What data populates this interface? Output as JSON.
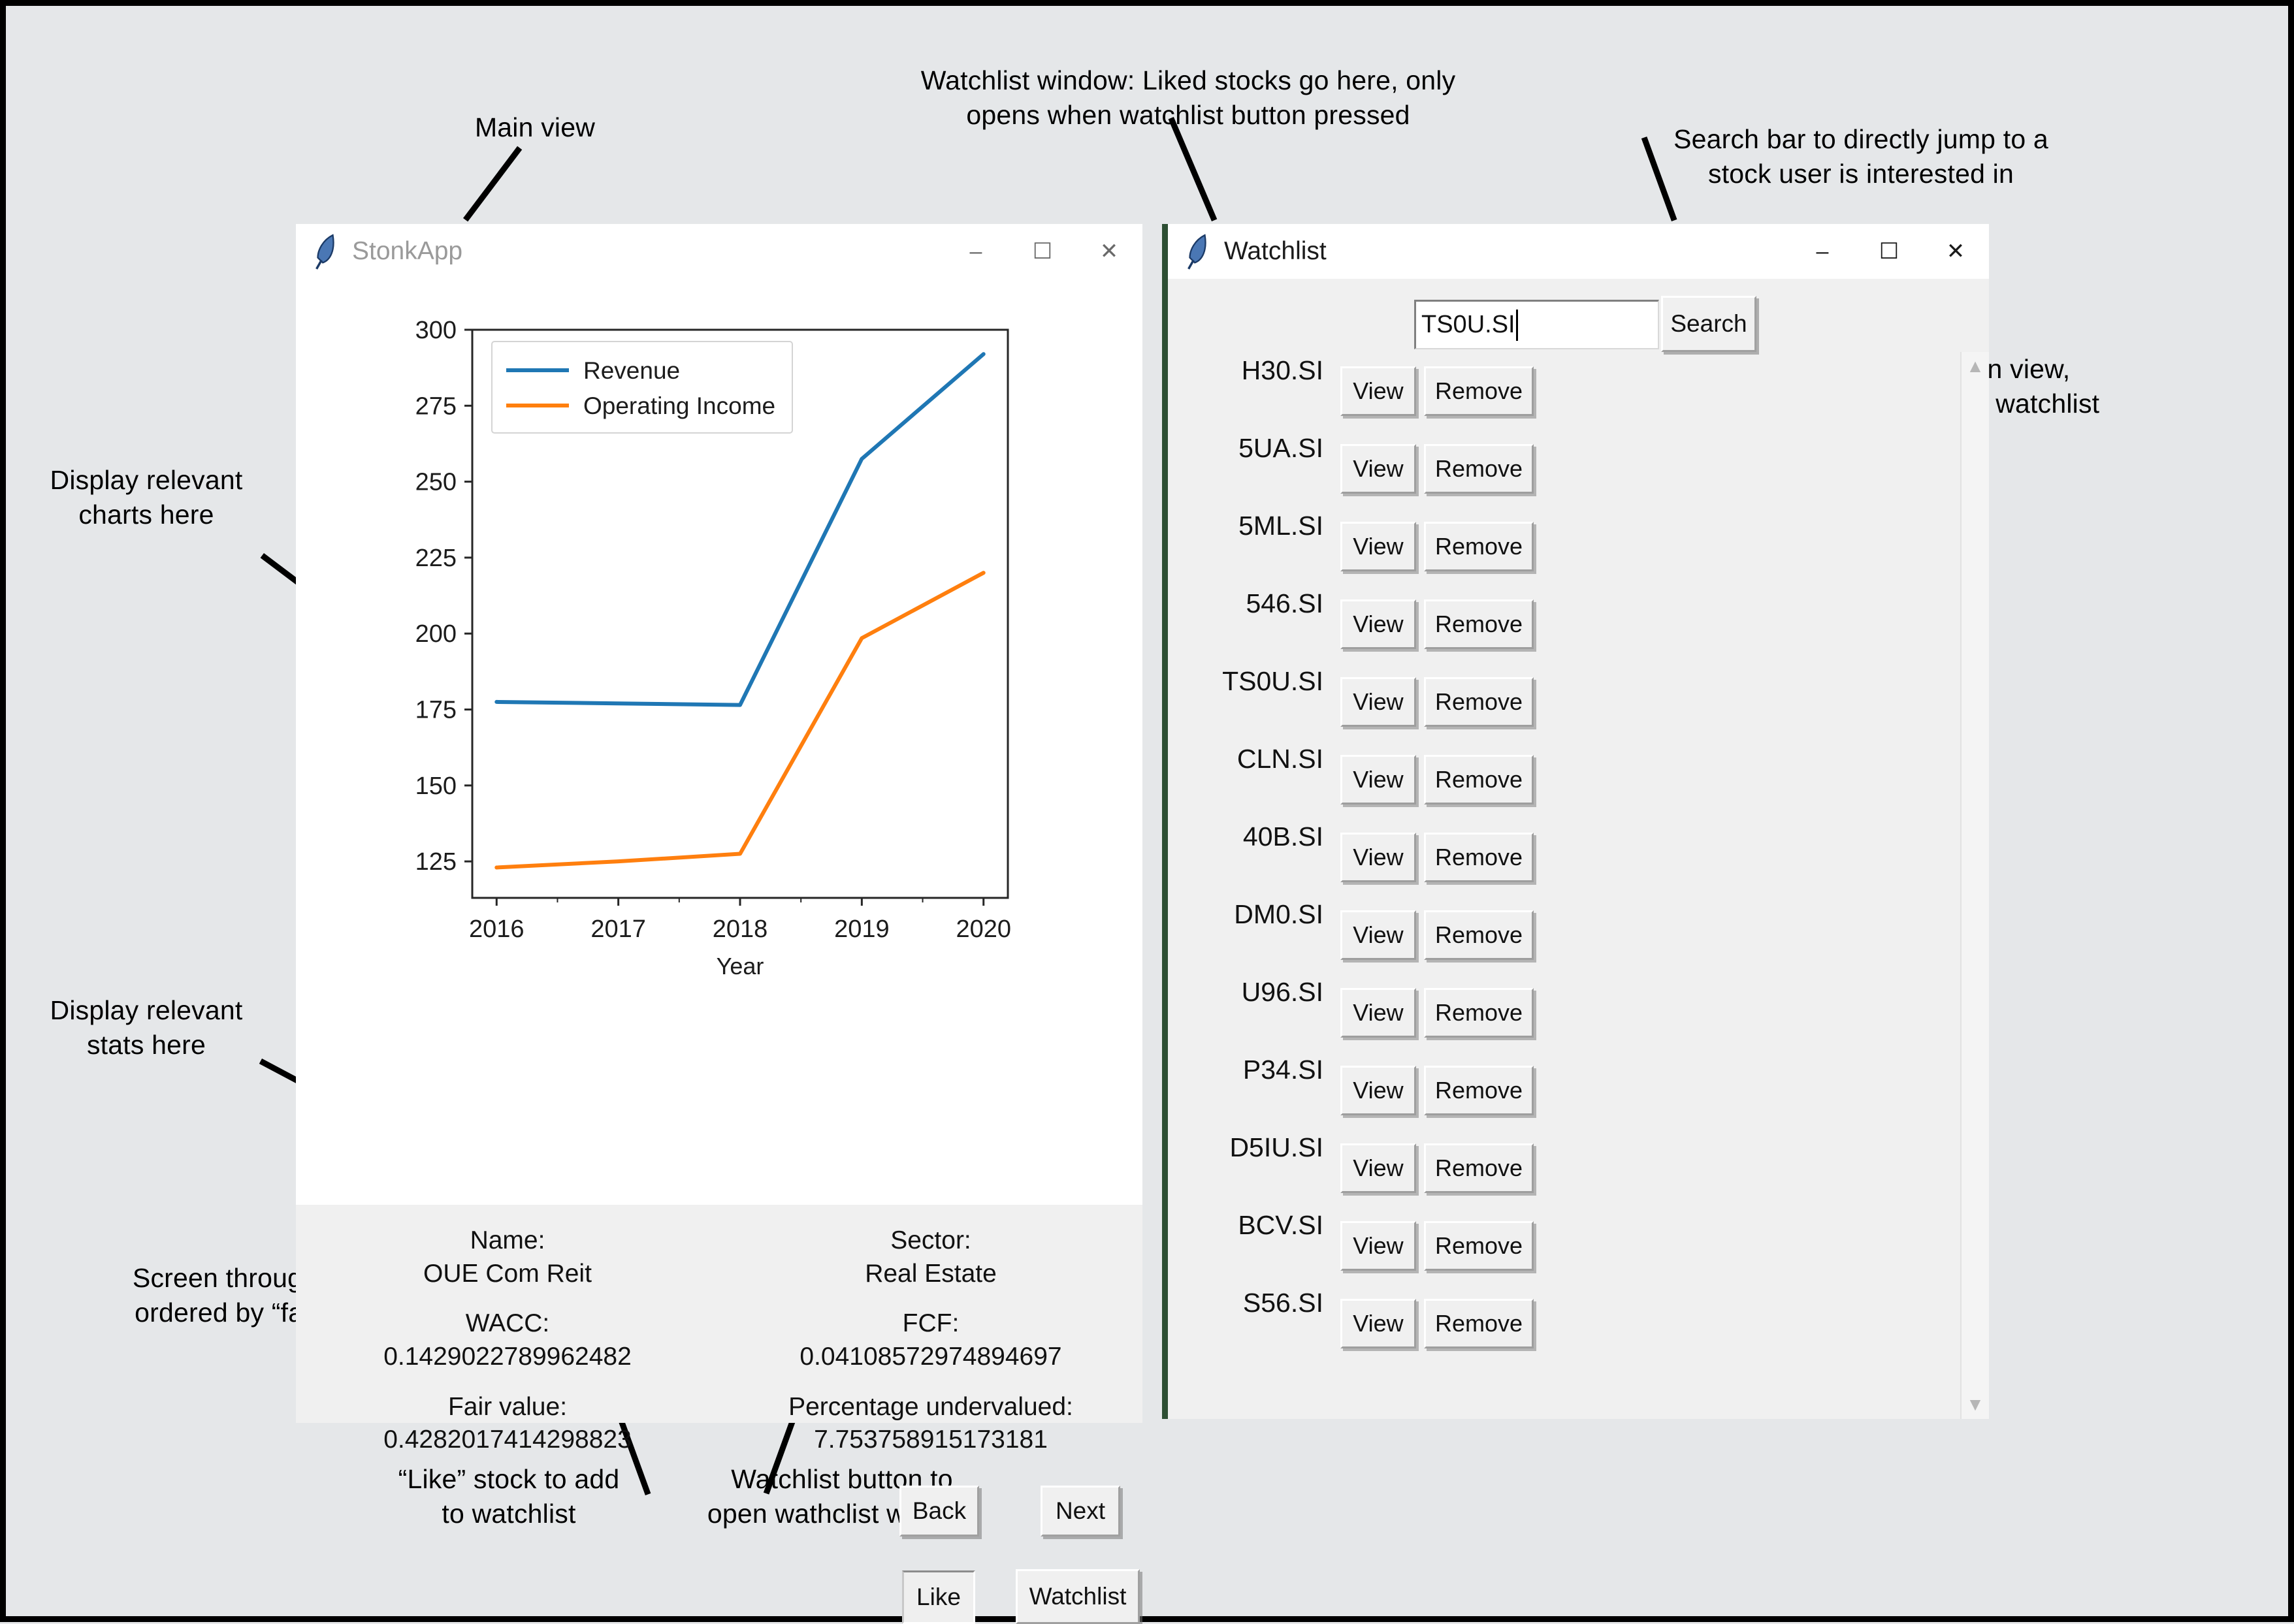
{
  "canvas": {
    "bg": "#e5e7e9",
    "border": "#000000"
  },
  "annotations": [
    {
      "name": "main-view",
      "text": "Main view"
    },
    {
      "name": "watchlist-window",
      "text": "Watchlist window: Liked stocks go here, only\nopens when watchlist button pressed"
    },
    {
      "name": "search-bar",
      "text": "Search bar to directly jump to a\nstock user is interested in"
    },
    {
      "name": "view-remove",
      "text": "“View” stock to display in main view,\n“Remove” stock to remove from watchlist"
    },
    {
      "name": "charts-here",
      "text": "Display relevant\ncharts here"
    },
    {
      "name": "stats-here",
      "text": "Display relevant\nstats here"
    },
    {
      "name": "screen-stocks",
      "text": "Screen through stocks\nordered by “fair value”"
    },
    {
      "name": "like-stock",
      "text": "“Like” stock to add\nto watchlist"
    },
    {
      "name": "watchlist-button",
      "text": "Watchlist button to\nopen wathclist window"
    }
  ],
  "stonkapp": {
    "title": "StonkApp",
    "icon": "feather-icon",
    "controls": {
      "minimize": "–",
      "maximize": "☐",
      "close": "✕"
    },
    "stats": [
      {
        "label": "Name:",
        "value": "OUE Com Reit"
      },
      {
        "label": "Sector:",
        "value": "Real Estate"
      },
      {
        "label": "WACC:",
        "value": "0.1429022789962482"
      },
      {
        "label": "FCF:",
        "value": "0.04108572974894697"
      },
      {
        "label": "Fair value:",
        "value": "0.4282017414298823"
      },
      {
        "label": "Percentage undervalued:",
        "value": "7.753758915173181"
      }
    ],
    "buttons": {
      "back": "Back",
      "next": "Next",
      "like": "Like",
      "watchlist": "Watchlist"
    }
  },
  "chart_data": {
    "type": "line",
    "title": "",
    "xlabel": "Year",
    "ylabel": "",
    "x": [
      2016,
      2017,
      2018,
      2019,
      2020
    ],
    "categories": [
      "2016",
      "2017",
      "2018",
      "2019",
      "2020"
    ],
    "series": [
      {
        "name": "Revenue",
        "color": "#1f77b4",
        "values": [
          177.5,
          177.0,
          176.5,
          257.5,
          292.0
        ]
      },
      {
        "name": "Operating Income",
        "color": "#ff7f0e",
        "values": [
          123.0,
          125.0,
          127.5,
          198.5,
          220.0
        ]
      }
    ],
    "xticks": [
      "2016",
      "2017",
      "2018",
      "2019",
      "2020"
    ],
    "yticks": [
      "125",
      "150",
      "175",
      "200",
      "225",
      "250",
      "275",
      "300"
    ],
    "ylim": [
      113,
      300
    ],
    "xlim": [
      2015.8,
      2020.2
    ],
    "grid": false,
    "legend_position": "upper left",
    "legend": [
      "Revenue",
      "Operating Income"
    ]
  },
  "watchlist": {
    "title": "Watchlist",
    "icon": "feather-icon",
    "controls": {
      "minimize": "–",
      "maximize": "☐",
      "close": "✕"
    },
    "accent_color": "#2d4f33",
    "search": {
      "value": "TS0U.SI",
      "button_label": "Search",
      "placeholder": ""
    },
    "row_actions": {
      "view": "View",
      "remove": "Remove"
    },
    "tickers": [
      "H30.SI",
      "5UA.SI",
      "5ML.SI",
      "546.SI",
      "TS0U.SI",
      "CLN.SI",
      "40B.SI",
      "DM0.SI",
      "U96.SI",
      "P34.SI",
      "D5IU.SI",
      "BCV.SI",
      "S56.SI"
    ],
    "scrollbar": {
      "up": "▲",
      "down": "▼"
    }
  }
}
